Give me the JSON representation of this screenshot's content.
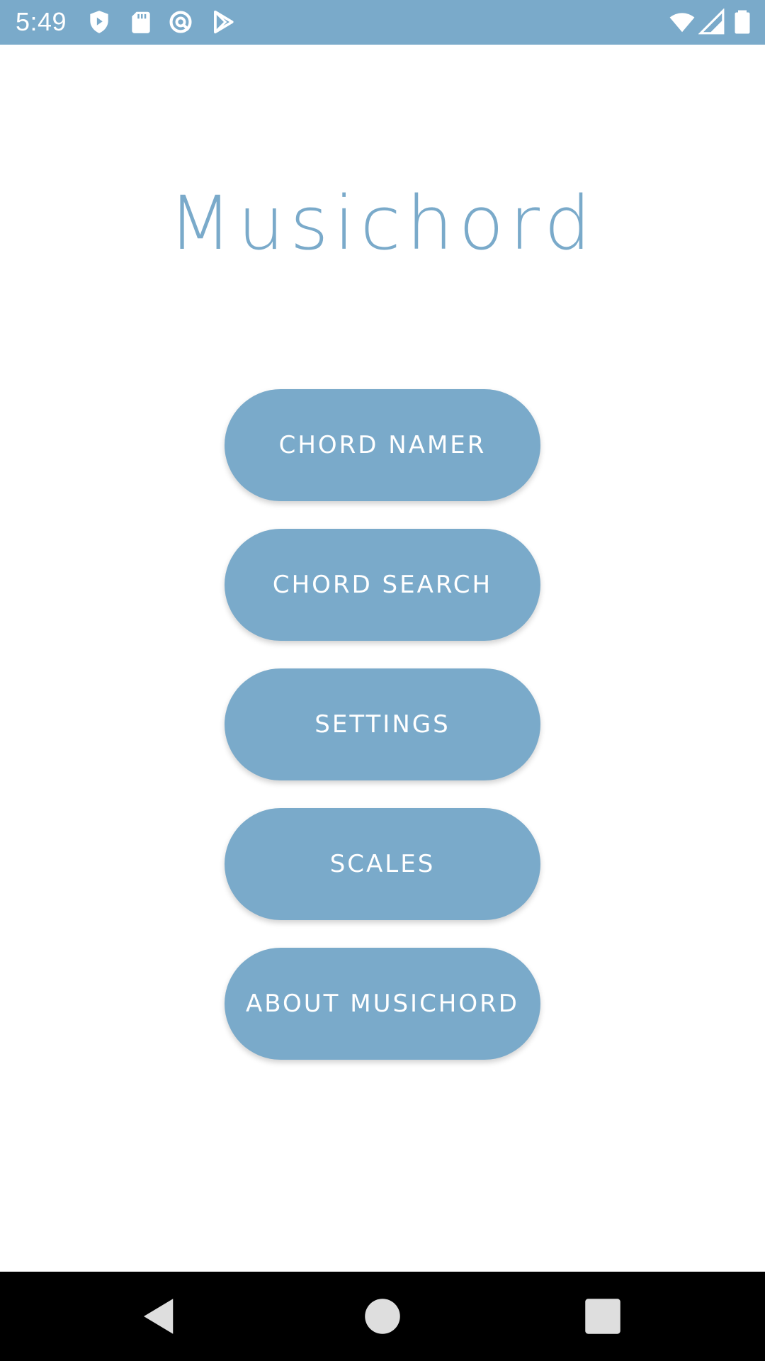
{
  "status_bar": {
    "time": "5:49",
    "background": "#7aaaca",
    "left_icons": [
      "shield-icon",
      "sd-card-icon",
      "sync-icon",
      "play-store-icon"
    ],
    "right_icons": [
      "wifi-icon",
      "cell-signal-icon",
      "battery-icon"
    ]
  },
  "app": {
    "title": "Musichord",
    "accent_color": "#7aaaca"
  },
  "menu": {
    "buttons": [
      {
        "label": "CHORD NAMER"
      },
      {
        "label": "CHORD SEARCH"
      },
      {
        "label": "SETTINGS"
      },
      {
        "label": "SCALES"
      },
      {
        "label": "ABOUT MUSICHORD"
      }
    ]
  },
  "nav_bar": {
    "icons": [
      "back-icon",
      "home-icon",
      "recents-icon"
    ]
  }
}
